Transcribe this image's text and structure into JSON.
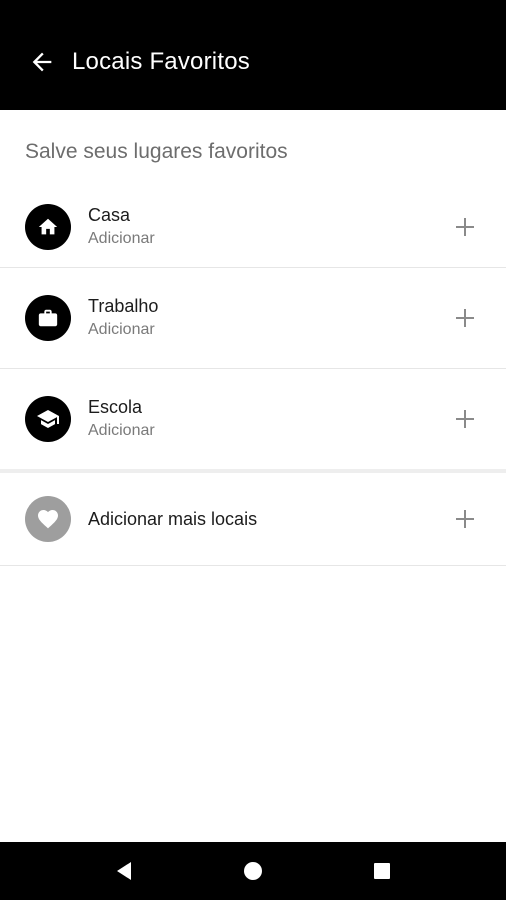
{
  "app_bar": {
    "title": "Locais Favoritos",
    "back_icon": "arrow-left-icon"
  },
  "section": {
    "header": "Salve seus lugares favoritos"
  },
  "favorites": [
    {
      "title": "Casa",
      "subtitle": "Adicionar",
      "icon": "home-icon"
    },
    {
      "title": "Trabalho",
      "subtitle": "Adicionar",
      "icon": "briefcase-icon"
    },
    {
      "title": "Escola",
      "subtitle": "Adicionar",
      "icon": "graduation-cap-icon"
    }
  ],
  "more": {
    "label": "Adicionar mais locais",
    "icon": "heart-icon"
  },
  "colors": {
    "app_bar": "#000000",
    "icon_badge": "#000000",
    "icon_badge_muted": "#9e9e9e",
    "plus": "#8a8a8a"
  },
  "nav": {
    "back": "nav-back-icon",
    "home": "nav-home-icon",
    "recents": "nav-recents-icon"
  }
}
